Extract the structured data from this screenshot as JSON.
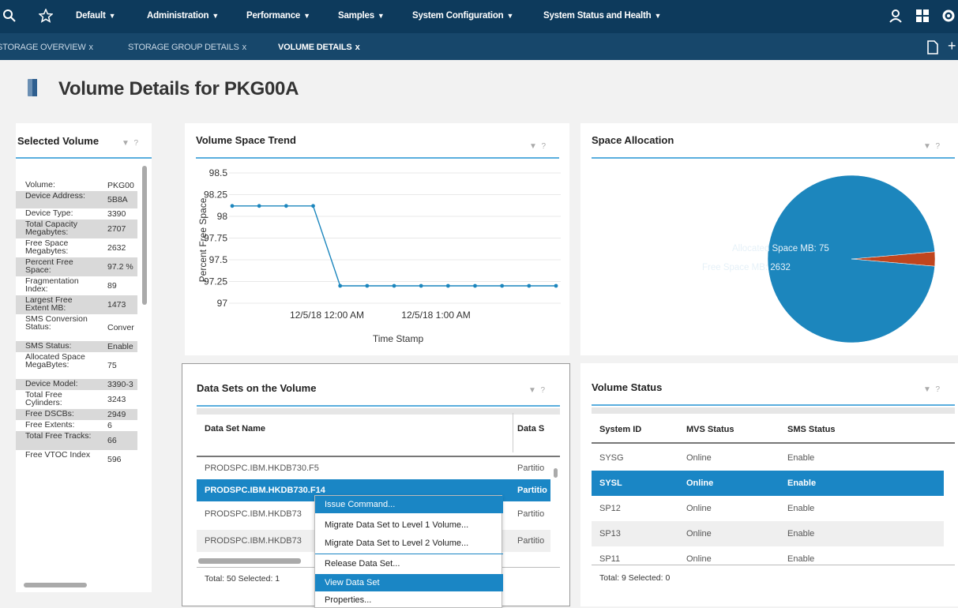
{
  "topbar": {
    "menus": [
      {
        "label": "Default"
      },
      {
        "label": "Administration"
      },
      {
        "label": "Performance"
      },
      {
        "label": "Samples"
      },
      {
        "label": "System Configuration"
      },
      {
        "label": "System Status and Health"
      }
    ],
    "icons": [
      "search-icon",
      "star-icon",
      "user-icon",
      "grid-icon",
      "gear-icon"
    ]
  },
  "tabs": [
    {
      "label": "STORAGE OVERVIEW",
      "close": "x"
    },
    {
      "label": "STORAGE GROUP DETAILS",
      "close": "x"
    },
    {
      "label": "VOLUME DETAILS",
      "close": "x"
    }
  ],
  "page": {
    "title": "Volume Details for PKG00A"
  },
  "selected_volume": {
    "title": "Selected Volume",
    "help": "?",
    "items": [
      {
        "k": "Volume:",
        "v": "PKG00"
      },
      {
        "k": "Device Address:",
        "v": "5B8A"
      },
      {
        "k": "Device Type:",
        "v": "3390"
      },
      {
        "k": "Total Capacity Megabytes:",
        "v": "2707"
      },
      {
        "k": "Free Space Megabytes:",
        "v": "2632"
      },
      {
        "k": "Percent Free Space:",
        "v": "97.2 %"
      },
      {
        "k": "Fragmentation Index:",
        "v": "89"
      },
      {
        "k": "Largest Free Extent MB:",
        "v": "1473"
      },
      {
        "k": "SMS Conversion Status:",
        "v": "Conver"
      },
      {
        "k": "SMS Status:",
        "v": "Enable"
      },
      {
        "k": "Allocated Space MegaBytes:",
        "v": "75"
      },
      {
        "k": "Device Model:",
        "v": "3390-3"
      },
      {
        "k": "Total Free Cylinders:",
        "v": "3243"
      },
      {
        "k": "Free DSCBs:",
        "v": "2949"
      },
      {
        "k": "Free Extents:",
        "v": "6"
      },
      {
        "k": "Total Free Tracks:",
        "v": "66"
      },
      {
        "k": "Free VTOC Index",
        "v": "596"
      }
    ]
  },
  "trend": {
    "title": "Volume Space Trend",
    "help": "?",
    "chart_data": {
      "type": "line",
      "ylabel": "Percent Free Space",
      "xlabel": "Time Stamp",
      "ylim": [
        97,
        98.5
      ],
      "yticks": [
        "98.5",
        "98.25",
        "98",
        "97.75",
        "97.5",
        "97.25",
        "97"
      ],
      "xticks": [
        "12/5/18 12:00 AM",
        "12/5/18 1:00 AM"
      ],
      "values": [
        98.12,
        98.12,
        98.12,
        98.12,
        97.2,
        97.2,
        97.2,
        97.2,
        97.2,
        97.2,
        97.2,
        97.2,
        97.2
      ]
    }
  },
  "allocation": {
    "title": "Space Allocation",
    "help": "?",
    "chart_data": {
      "type": "pie",
      "slices": [
        {
          "label": "Allocated Space MB: 75",
          "value": 75,
          "color": "#c0451e"
        },
        {
          "label": "Free Space MB: 2632",
          "value": 2632,
          "color": "#1c86bd"
        }
      ]
    }
  },
  "datasets": {
    "title": "Data Sets on the Volume",
    "help": "?",
    "columns": [
      "Data Set Name",
      "Data S"
    ],
    "rows": [
      {
        "name": "PRODSPC.IBM.HKDB730.F5",
        "type": "Partitio"
      },
      {
        "name": "PRODSPC.IBM.HKDB730.F14",
        "type": "Partitio"
      },
      {
        "name": "PRODSPC.IBM.HKDB73",
        "type": "Partitio"
      },
      {
        "name": "PRODSPC.IBM.HKDB73",
        "type": "Partitio"
      }
    ],
    "footer": "Total: 50 Selected: 1"
  },
  "context_menu": {
    "items": [
      "Issue Command...",
      "Migrate Data Set to Level 1 Volume...",
      "Migrate Data Set to Level 2 Volume...",
      "Release Data Set...",
      "View Data Set",
      "Properties..."
    ]
  },
  "status": {
    "title": "Volume Status",
    "help": "?",
    "columns": [
      "System ID",
      "MVS Status",
      "SMS Status"
    ],
    "rows": [
      {
        "id": "SYSG",
        "mvs": "Online",
        "sms": "Enable"
      },
      {
        "id": "SYSL",
        "mvs": "Online",
        "sms": "Enable"
      },
      {
        "id": "SP12",
        "mvs": "Online",
        "sms": "Enable"
      },
      {
        "id": "SP13",
        "mvs": "Online",
        "sms": "Enable"
      },
      {
        "id": "SP11",
        "mvs": "Online",
        "sms": "Enable"
      }
    ],
    "footer": "Total: 9 Selected: 0"
  }
}
